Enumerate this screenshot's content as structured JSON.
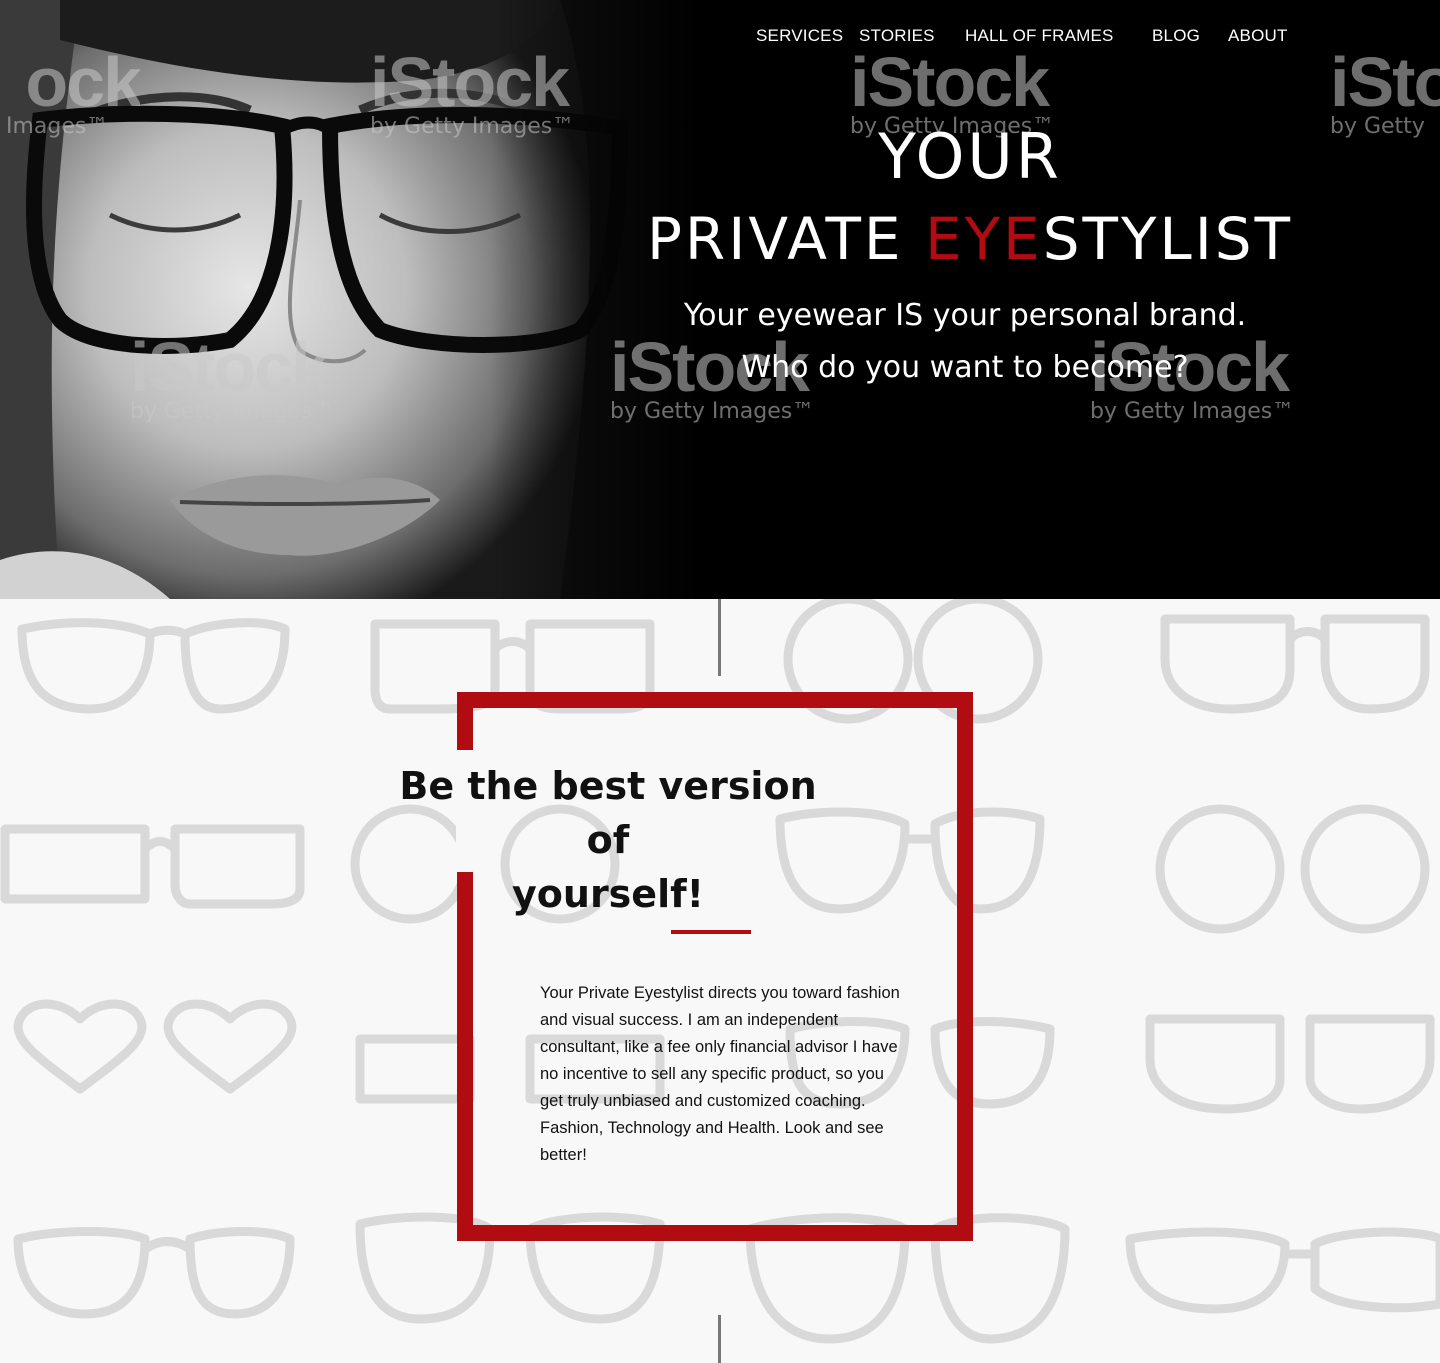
{
  "nav": {
    "services": "SERVICES",
    "stories": "STORIES",
    "hall_of_frames": "HALL OF FRAMES",
    "blog": "BLOG",
    "about": "ABOUT"
  },
  "hero": {
    "title_line1": "YOUR",
    "title_private": "PRIVATE ",
    "title_eye": "EYE",
    "title_stylist": "STYLIST",
    "subtitle_line1": "Your eyewear IS your personal brand.",
    "subtitle_line2": "Who do you want to become?"
  },
  "watermark": {
    "brand": "iStock",
    "byline": "by Getty Images™",
    "partial_brand_left": "ock",
    "partial_byline_left": "Images™",
    "partial_brand_right": "iSto",
    "partial_byline_right": "by Getty"
  },
  "card": {
    "heading_line1": "Be the best version of",
    "heading_line2": "yourself!",
    "body": "Your Private Eyestylist directs you toward fashion and visual success. I am an independent consultant, like a fee only financial advisor I have no incentive to sell any specific product, so you get truly unbiased and customized coaching.  Fashion, Technology and Health. Look and see better!"
  },
  "colors": {
    "accent": "#b10c12",
    "hero_background": "#000000",
    "section_background": "#f8f8f8"
  }
}
